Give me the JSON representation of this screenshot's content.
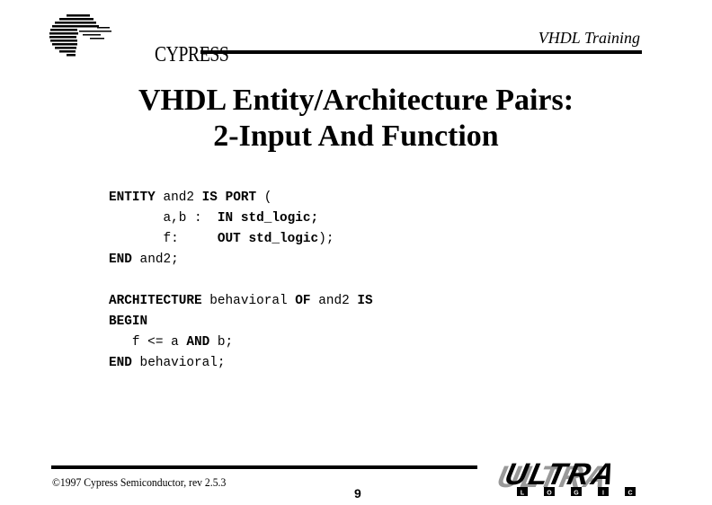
{
  "header": {
    "logo_text": "CYPRESS",
    "course_tag": "VHDL Training"
  },
  "title": {
    "line1": "VHDL Entity/Architecture Pairs:",
    "line2": "2-Input And Function"
  },
  "code": {
    "entity": [
      [
        {
          "t": "ENTITY",
          "k": true
        },
        {
          "t": " and2 "
        },
        {
          "t": "IS",
          "k": true
        },
        {
          "t": " "
        },
        {
          "t": "PORT",
          "k": true
        },
        {
          "t": " ("
        }
      ],
      [
        {
          "t": "       a,b :  "
        },
        {
          "t": "IN",
          "k": true
        },
        {
          "t": " "
        },
        {
          "t": "std_logic;",
          "k": true
        }
      ],
      [
        {
          "t": "       f:     "
        },
        {
          "t": "OUT",
          "k": true
        },
        {
          "t": " "
        },
        {
          "t": "std_logic",
          "k": true
        },
        {
          "t": ");"
        }
      ],
      [
        {
          "t": "END",
          "k": true
        },
        {
          "t": " and2;"
        }
      ]
    ],
    "architecture": [
      [
        {
          "t": "ARCHITECTURE",
          "k": true
        },
        {
          "t": " behavioral "
        },
        {
          "t": "OF",
          "k": true
        },
        {
          "t": " and2 "
        },
        {
          "t": "IS",
          "k": true
        }
      ],
      [
        {
          "t": "BEGIN",
          "k": true
        }
      ],
      [
        {
          "t": "   f <= a "
        },
        {
          "t": "AND",
          "k": true
        },
        {
          "t": " b;"
        }
      ],
      [
        {
          "t": "END",
          "k": true
        },
        {
          "t": " behavioral;"
        }
      ]
    ]
  },
  "footer": {
    "copyright": "©1997 Cypress Semiconductor, rev 2.5.3",
    "page_number": "9",
    "brand_top": "ULTRA",
    "brand_bottom": [
      "L",
      "O",
      "G",
      "I",
      "C"
    ]
  }
}
